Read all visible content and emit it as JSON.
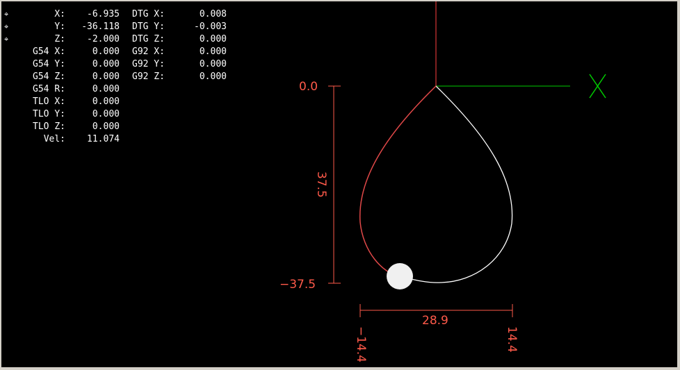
{
  "dro": {
    "rows": [
      {
        "label": "X:",
        "value": "-6.935",
        "label2": "DTG X:",
        "value2": "0.008",
        "homed": true
      },
      {
        "label": "Y:",
        "value": "-36.118",
        "label2": "DTG Y:",
        "value2": "-0.003",
        "homed": true
      },
      {
        "label": "Z:",
        "value": "-2.000",
        "label2": "DTG Z:",
        "value2": "0.000",
        "homed": true
      },
      {
        "label": "G54 X:",
        "value": "0.000",
        "label2": "G92 X:",
        "value2": "0.000"
      },
      {
        "label": "G54 Y:",
        "value": "0.000",
        "label2": "G92 Y:",
        "value2": "0.000"
      },
      {
        "label": "G54 Z:",
        "value": "0.000",
        "label2": "G92 Z:",
        "value2": "0.000"
      },
      {
        "label": "G54 R:",
        "value": "0.000"
      },
      {
        "label": "TLO X:",
        "value": "0.000"
      },
      {
        "label": "TLO Y:",
        "value": "0.000"
      },
      {
        "label": "TLO Z:",
        "value": "0.000"
      },
      {
        "label": "Vel:",
        "value": "11.074"
      }
    ]
  },
  "plot": {
    "axis_label": "X",
    "dimensions": {
      "y_top": "0.0",
      "y_bottom": "−37.5",
      "y_span": "37.5",
      "x_left": "−14.4",
      "x_right": "14.4",
      "x_span": "28.9"
    },
    "colors": {
      "background": "#000000",
      "dimension": "#ff5a4a",
      "y_axis": "#ff4040",
      "x_axis": "#00cc00",
      "feed_path": "#ffffff",
      "traversed_path": "#ff4040",
      "tool": "#ffffff"
    }
  }
}
